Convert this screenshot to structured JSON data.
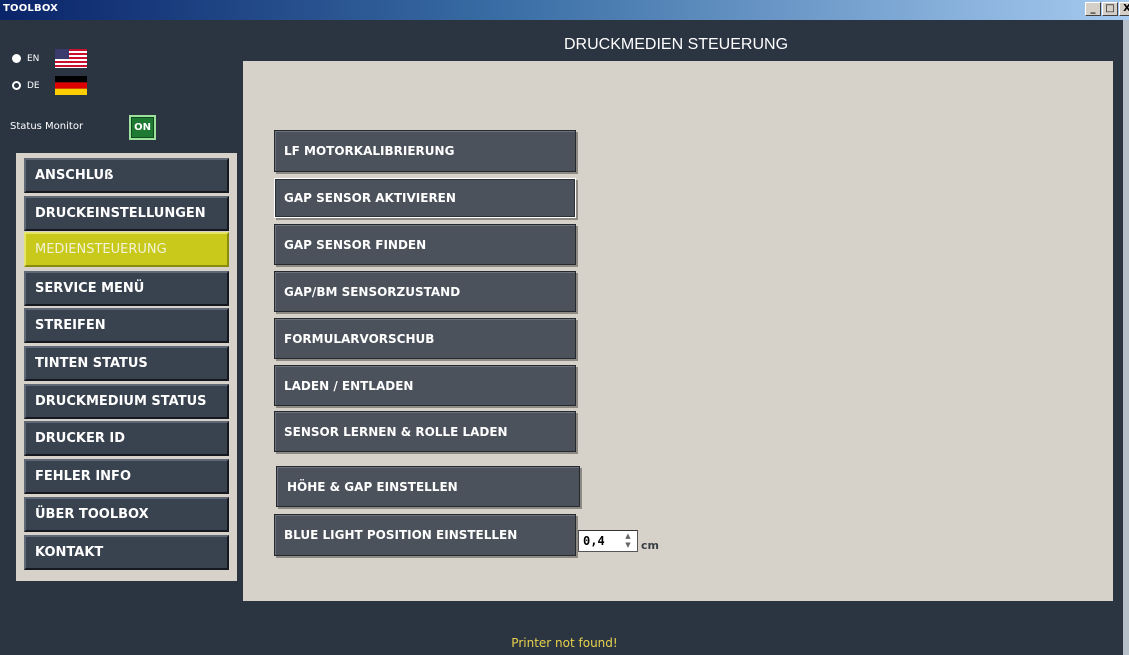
{
  "window": {
    "title": "TOOLBOX",
    "controls": {
      "minimize": "_",
      "maximize": "□",
      "close": "X"
    }
  },
  "language": {
    "options": [
      {
        "label": "EN",
        "flag": "us-flag-icon",
        "selected": false
      },
      {
        "label": "DE",
        "flag": "germany-flag-icon",
        "selected": true
      }
    ]
  },
  "status_monitor": {
    "label": "Status Monitor",
    "toggle": "ON"
  },
  "sidebar": {
    "items": [
      {
        "label": "ANSCHLUß",
        "active": false
      },
      {
        "label": "DRUCKEINSTELLUNGEN",
        "active": false
      },
      {
        "label": "MEDIENSTEUERUNG",
        "active": true
      },
      {
        "label": "SERVICE MENÜ",
        "active": false
      },
      {
        "label": "STREIFEN",
        "active": false
      },
      {
        "label": "TINTEN STATUS",
        "active": false
      },
      {
        "label": "DRUCKMEDIUM STATUS",
        "active": false
      },
      {
        "label": "DRUCKER ID",
        "active": false
      },
      {
        "label": "FEHLER INFO",
        "active": false
      },
      {
        "label": "ÜBER TOOLBOX",
        "active": false
      },
      {
        "label": "KONTAKT",
        "active": false
      }
    ]
  },
  "main": {
    "title": "DRUCKMEDIEN STEUERUNG",
    "buttons": [
      {
        "label": "LF MOTORKALIBRIERUNG"
      },
      {
        "label": "GAP SENSOR AKTIVIEREN"
      },
      {
        "label": "GAP SENSOR FINDEN"
      },
      {
        "label": "GAP/BM SENSORZUSTAND"
      },
      {
        "label": "FORMULARVORSCHUB"
      },
      {
        "label": "LADEN / ENTLADEN"
      },
      {
        "label": "SENSOR LERNEN & ROLLE LADEN"
      },
      {
        "label": "HÖHE & GAP EINSTELLEN"
      },
      {
        "label": "BLUE LIGHT POSITION EINSTELLEN"
      }
    ],
    "blue_light": {
      "value": "0,4",
      "unit": "cm"
    }
  },
  "status_message": "Printer not found!",
  "colors": {
    "background": "#2b3542",
    "panel": "#d6d2c9",
    "nav_button": "#39424f",
    "nav_active": "#c8c91a",
    "action_button": "#4b525b",
    "status_on": "#1e7a32",
    "status_message": "#e8d24c"
  }
}
